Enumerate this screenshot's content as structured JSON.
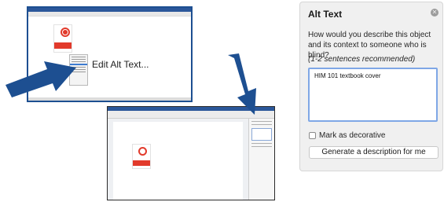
{
  "caption": {
    "menu_item": "Edit Alt Text..."
  },
  "panel": {
    "title": "Alt Text",
    "question": "How would you describe this object and its context to someone who is blind?",
    "hint": "(1-2 sentences recommended)",
    "alt_value": "HIM 101 textbook cover",
    "decorative_label": "Mark as decorative",
    "decorative_checked": false,
    "generate_label": "Generate a description for me",
    "close_icon": "close-icon"
  },
  "colors": {
    "arrow": "#1d4f91",
    "word_blue": "#2b579a",
    "cover_red": "#e23a2b",
    "input_border": "#7fa7e6"
  }
}
